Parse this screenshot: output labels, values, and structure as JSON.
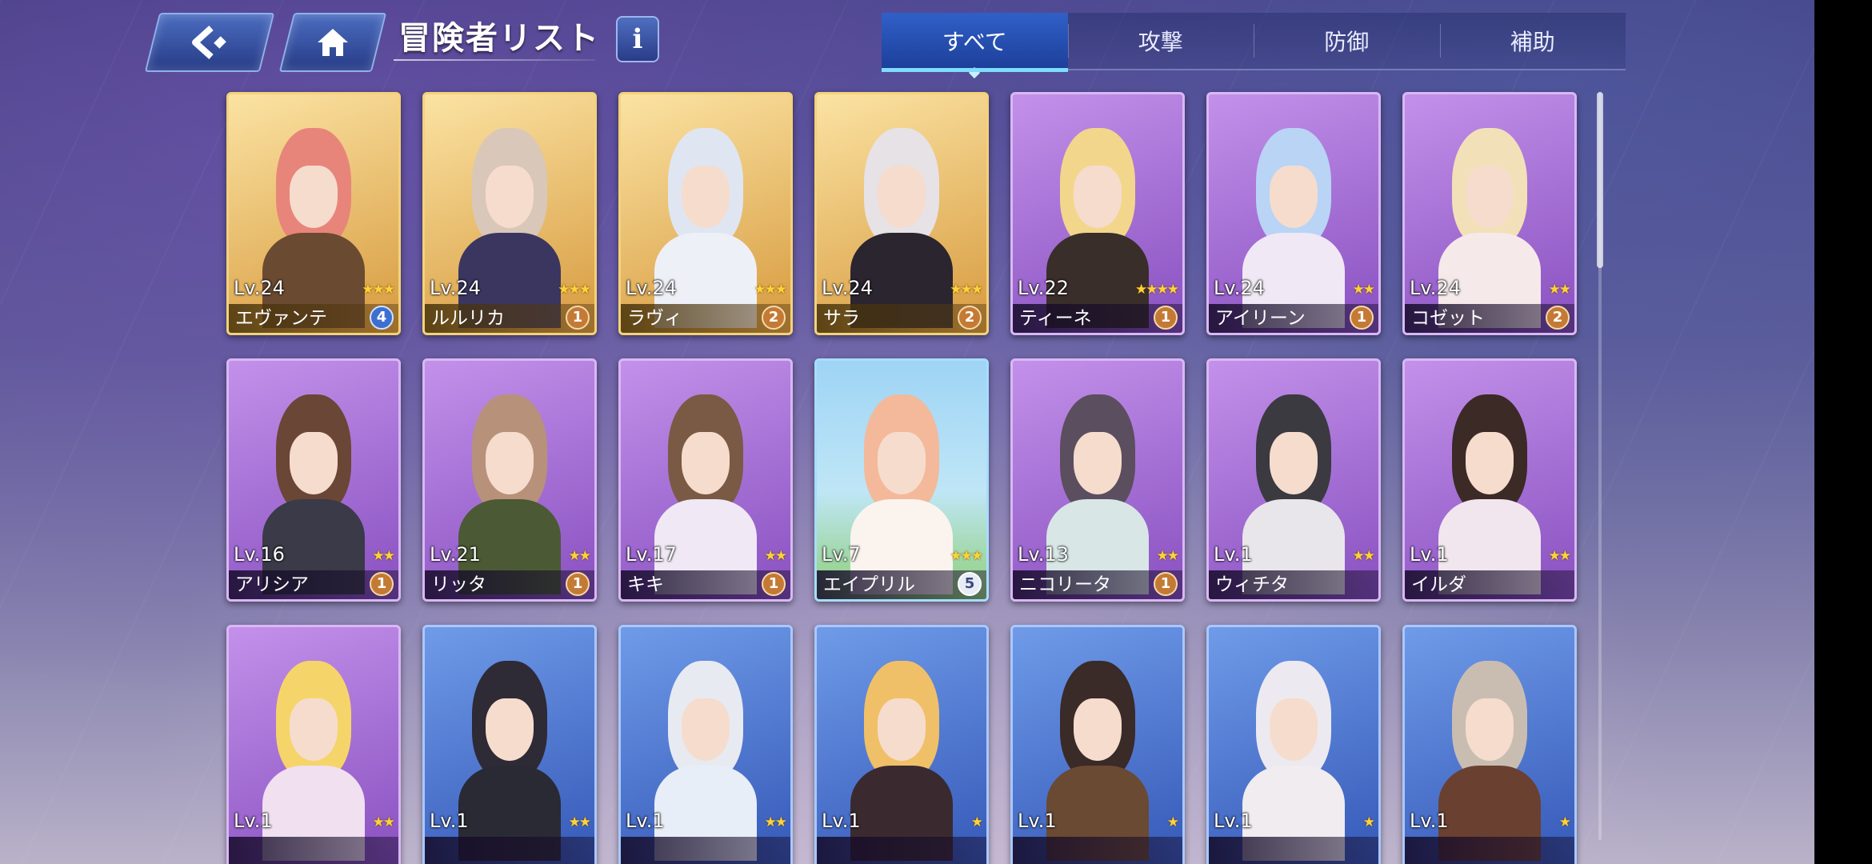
{
  "header": {
    "back_icon": "back-arrow-icon",
    "home_icon": "home-icon",
    "title": "冒険者リスト",
    "info_label": "i"
  },
  "tabs": [
    {
      "label": "すべて",
      "active": true
    },
    {
      "label": "攻撃",
      "active": false
    },
    {
      "label": "防御",
      "active": false
    },
    {
      "label": "補助",
      "active": false
    }
  ],
  "colors": {
    "gold_frame": "#f3d27a",
    "purple_frame": "#c391ea",
    "blue_frame": "#6f9be8",
    "star": "#ffd23a",
    "active_tab": "#3060c8"
  },
  "characters": [
    {
      "lv": "Lv.24",
      "name": "エヴァンテ",
      "stars": 3,
      "badge": "4",
      "frame": "gold",
      "badge_style": "blue",
      "hair": "#e8857a",
      "outfit": "#6b4a32"
    },
    {
      "lv": "Lv.24",
      "name": "ルルリカ",
      "stars": 3,
      "badge": "1",
      "frame": "gold",
      "badge_style": "bronze",
      "hair": "#d9c7b9",
      "outfit": "#3a3660"
    },
    {
      "lv": "Lv.24",
      "name": "ラヴィ",
      "stars": 3,
      "badge": "2",
      "frame": "gold",
      "badge_style": "bronze",
      "hair": "#dfe6f2",
      "outfit": "#eef0f8"
    },
    {
      "lv": "Lv.24",
      "name": "サラ",
      "stars": 3,
      "badge": "2",
      "frame": "gold",
      "badge_style": "bronze",
      "hair": "#e6e2e6",
      "outfit": "#2b2530"
    },
    {
      "lv": "Lv.22",
      "name": "ティーネ",
      "stars": 4,
      "badge": "1",
      "frame": "purple",
      "badge_style": "bronze",
      "hair": "#f2d68c",
      "outfit": "#3a2e2a"
    },
    {
      "lv": "Lv.24",
      "name": "アイリーン",
      "stars": 2,
      "badge": "1",
      "frame": "purple",
      "badge_style": "bronze",
      "hair": "#b9d4f5",
      "outfit": "#f0e8f5"
    },
    {
      "lv": "Lv.24",
      "name": "コゼット",
      "stars": 2,
      "badge": "2",
      "frame": "purple",
      "badge_style": "bronze",
      "hair": "#f2e0b8",
      "outfit": "#f6e9ea"
    },
    {
      "lv": "Lv.16",
      "name": "アリシア",
      "stars": 2,
      "badge": "1",
      "frame": "purple",
      "badge_style": "bronze",
      "hair": "#6a4636",
      "outfit": "#3a3a48"
    },
    {
      "lv": "Lv.21",
      "name": "リッタ",
      "stars": 2,
      "badge": "1",
      "frame": "purple",
      "badge_style": "bronze",
      "hair": "#b8917a",
      "outfit": "#4b5a34"
    },
    {
      "lv": "Lv.17",
      "name": "キキ",
      "stars": 2,
      "badge": "1",
      "frame": "purple",
      "badge_style": "bronze",
      "hair": "#7a5a45",
      "outfit": "#f0e8f5"
    },
    {
      "lv": "Lv.7",
      "name": "エイプリル",
      "stars": 3,
      "badge": "5",
      "frame": "sky",
      "badge_style": "white",
      "hair": "#f3b99a",
      "outfit": "#fbf4ee"
    },
    {
      "lv": "Lv.13",
      "name": "ニコリータ",
      "stars": 2,
      "badge": "1",
      "frame": "purple",
      "badge_style": "bronze",
      "hair": "#5b4e5e",
      "outfit": "#d8e6e6"
    },
    {
      "lv": "Lv.1",
      "name": "ウィチタ",
      "stars": 2,
      "badge": "",
      "frame": "purple",
      "badge_style": "none",
      "hair": "#3a3a40",
      "outfit": "#e8e6ea"
    },
    {
      "lv": "Lv.1",
      "name": "イルダ",
      "stars": 2,
      "badge": "",
      "frame": "purple",
      "badge_style": "none",
      "hair": "#3b2a26",
      "outfit": "#f2e6ee"
    },
    {
      "lv": "Lv.1",
      "name": "",
      "stars": 2,
      "badge": "",
      "frame": "purple",
      "badge_style": "none",
      "hair": "#f5d56a",
      "outfit": "#f0e0f0"
    },
    {
      "lv": "Lv.1",
      "name": "",
      "stars": 2,
      "badge": "",
      "frame": "blue",
      "badge_style": "none",
      "hair": "#2e2a36",
      "outfit": "#2a2a34"
    },
    {
      "lv": "Lv.1",
      "name": "",
      "stars": 2,
      "badge": "",
      "frame": "blue",
      "badge_style": "none",
      "hair": "#e8eaf2",
      "outfit": "#e8eef8"
    },
    {
      "lv": "Lv.1",
      "name": "",
      "stars": 1,
      "badge": "",
      "frame": "blue",
      "badge_style": "none",
      "hair": "#f0c068",
      "outfit": "#3a2a30"
    },
    {
      "lv": "Lv.1",
      "name": "",
      "stars": 1,
      "badge": "",
      "frame": "blue",
      "badge_style": "none",
      "hair": "#3a2a28",
      "outfit": "#6a4a32"
    },
    {
      "lv": "Lv.1",
      "name": "",
      "stars": 1,
      "badge": "",
      "frame": "blue",
      "badge_style": "none",
      "hair": "#eceaf0",
      "outfit": "#f0ecf0"
    },
    {
      "lv": "Lv.1",
      "name": "",
      "stars": 1,
      "badge": "",
      "frame": "blue",
      "badge_style": "none",
      "hair": "#c9bdb2",
      "outfit": "#6a4030"
    }
  ]
}
